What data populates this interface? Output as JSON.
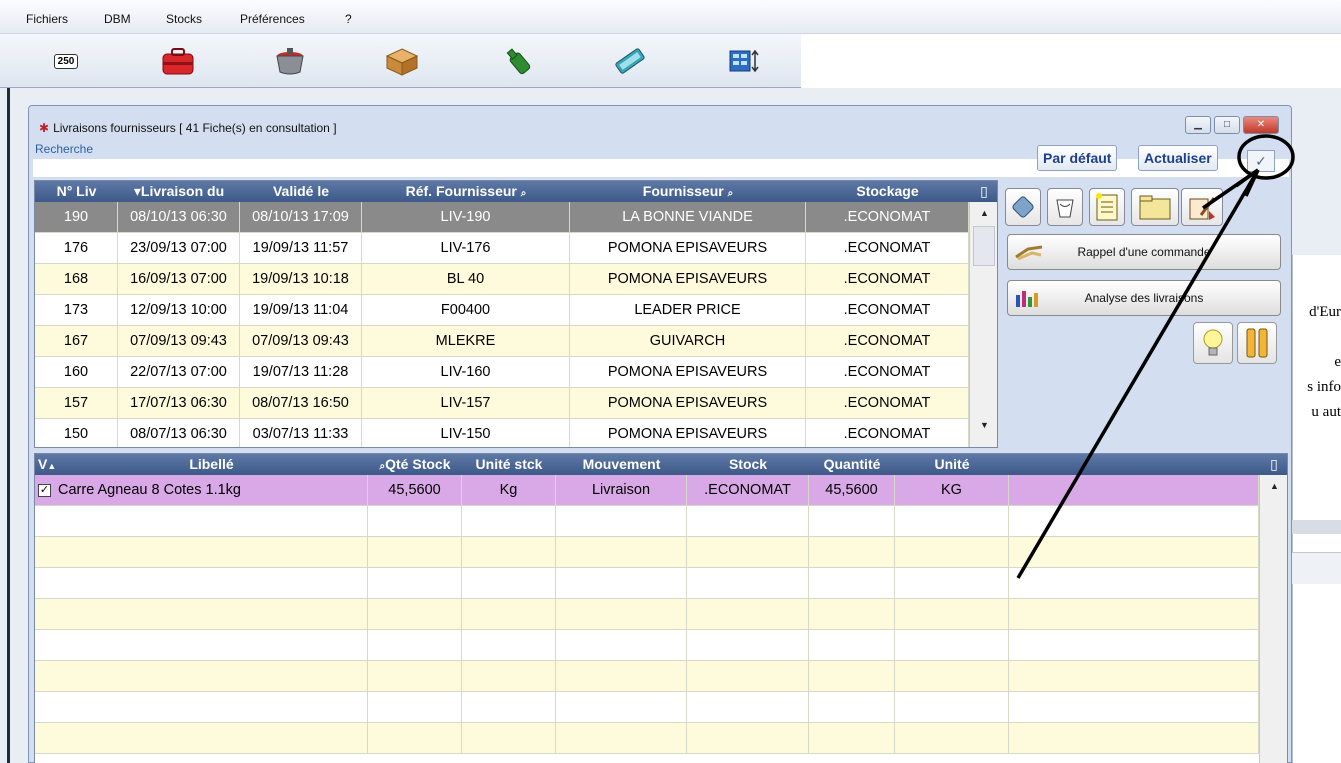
{
  "menu": [
    "Fichiers",
    "DBM",
    "Stocks",
    "Préférences",
    "?"
  ],
  "toolbar": {
    "badge_label": "250",
    "icons": [
      "counter-icon",
      "toolbox-icon",
      "cooking-pot-icon",
      "box-icon",
      "bottle-icon",
      "scanner-icon",
      "grid-sort-icon"
    ]
  },
  "window": {
    "title": "Livraisons fournisseurs  [ 41 Fiche(s) en consultation ]",
    "subtitle": "Recherche",
    "btn_default": "Par défaut",
    "btn_refresh": "Actualiser",
    "check_glyph": "✓"
  },
  "deliveries": {
    "columns": [
      "N° Liv",
      "Livraison du",
      "Validé le",
      "Réf. Fournisseur",
      "Fournisseur",
      "Stockage"
    ],
    "rows": [
      [
        "190",
        "08/10/13 06:30",
        "08/10/13 17:09",
        "LIV-190",
        "LA BONNE VIANDE",
        ".ECONOMAT"
      ],
      [
        "176",
        "23/09/13 07:00",
        "19/09/13 11:57",
        "LIV-176",
        "POMONA EPISAVEURS",
        ".ECONOMAT"
      ],
      [
        "168",
        "16/09/13 07:00",
        "19/09/13 10:18",
        "BL 40",
        "POMONA EPISAVEURS",
        ".ECONOMAT"
      ],
      [
        "173",
        "12/09/13 10:00",
        "19/09/13 11:04",
        "F00400",
        "LEADER PRICE",
        ".ECONOMAT"
      ],
      [
        "167",
        "07/09/13 09:43",
        "07/09/13 09:43",
        "MLEKRE",
        "GUIVARCH",
        ".ECONOMAT"
      ],
      [
        "160",
        "22/07/13 07:00",
        "19/07/13 11:28",
        "LIV-160",
        "POMONA EPISAVEURS",
        ".ECONOMAT"
      ],
      [
        "157",
        "17/07/13 06:30",
        "08/07/13 16:50",
        "LIV-157",
        "POMONA EPISAVEURS",
        ".ECONOMAT"
      ],
      [
        "150",
        "08/07/13 06:30",
        "03/07/13 11:33",
        "LIV-150",
        "POMONA EPISAVEURS",
        ".ECONOMAT"
      ]
    ]
  },
  "actions": {
    "recall_order": "Rappel d'une commande",
    "analyze": "Analyse des livraisons"
  },
  "lines": {
    "columns": [
      "V",
      "Libellé",
      "Qté Stock",
      "Unité stck",
      "Mouvement",
      "Stock",
      "Quantité",
      "Unité"
    ],
    "rows": [
      [
        "✓",
        "Carre Agneau 8 Cotes 1.1kg",
        "45,5600",
        "Kg",
        "Livraison",
        ".ECONOMAT",
        "45,5600",
        "KG"
      ]
    ]
  },
  "background_text": [
    "d'Eur",
    "e",
    "s info",
    "u aut"
  ],
  "colors": {
    "header": "#4a6594",
    "selected_row": "#8a8a8a",
    "row_white": "#ffffff",
    "row_yellow": "#fdfbdc",
    "lines_row": "#d9a8e6",
    "annotation": "#000000"
  }
}
